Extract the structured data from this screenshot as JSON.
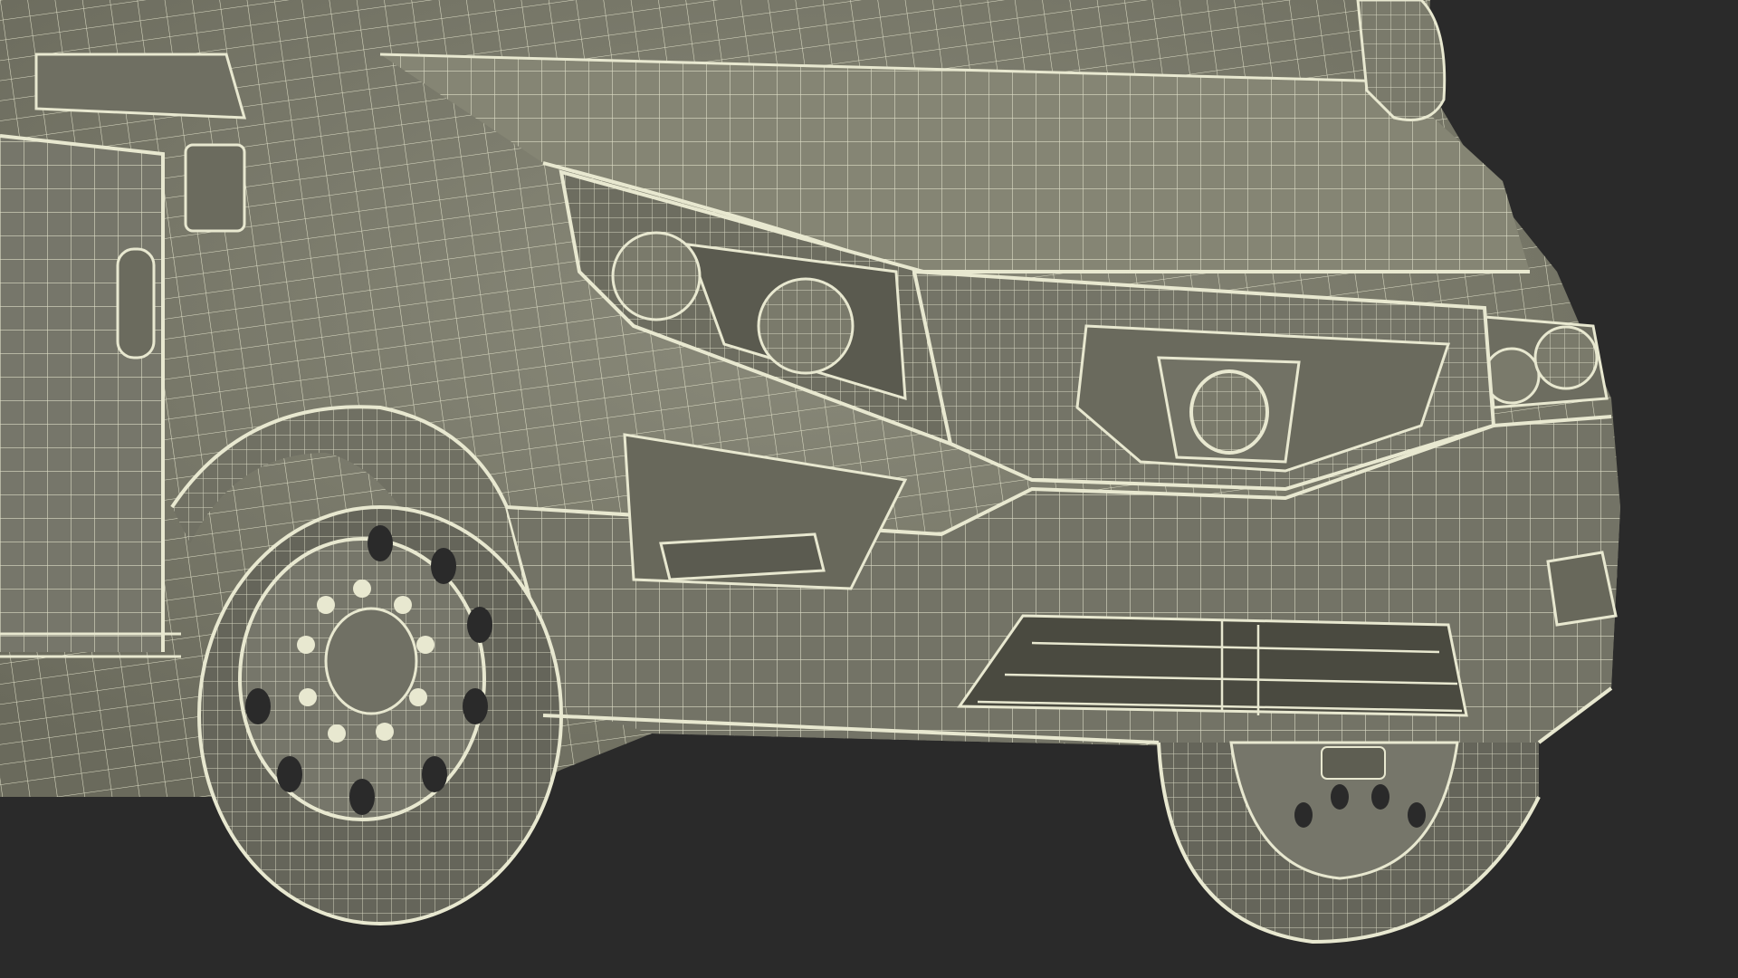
{
  "scene": {
    "subject": "van-front-wireframe",
    "background_color": "#2a2a2a",
    "surface_color": "#7b7b6c",
    "surface_dark_color": "#5d5d51",
    "wire_color": "#e8e8d0",
    "interior_color": "#4a4a40"
  }
}
